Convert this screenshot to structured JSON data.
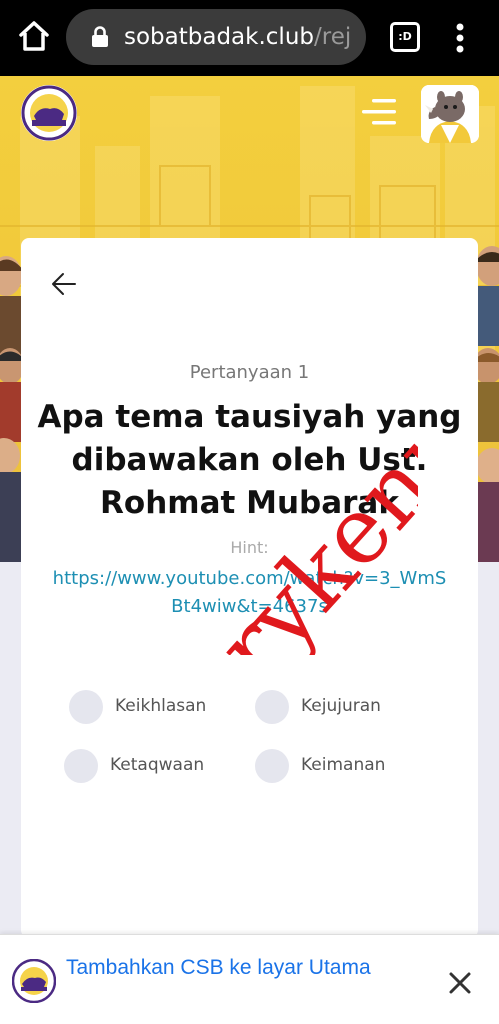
{
  "browser": {
    "url_host": "sobatbadak.club",
    "url_path": "/rej",
    "tab_count": ":D"
  },
  "site": {
    "logo_icon": "csb-logo-icon",
    "menu_icon": "hamburger-icon",
    "avatar_icon": "rhino-avatar-icon"
  },
  "quiz": {
    "question_number": "Pertanyaan 1",
    "question_text": "Apa tema tausiyah yang dibawakan oleh Ust. Rohmat Mubarak",
    "hint_label": "Hint:",
    "hint_link": "https://www.youtube.com/watch?v=3_WmSBt4wiw&t=4637s",
    "options": [
      {
        "label": "Keikhlasan"
      },
      {
        "label": "Kejujuran"
      },
      {
        "label": "Ketaqwaan"
      },
      {
        "label": "Keimanan"
      }
    ]
  },
  "watermark": "rykenpb",
  "add_to_home": {
    "text": "Tambahkan CSB ke layar Utama"
  },
  "colors": {
    "hero_yellow": "#f2c93a",
    "link": "#1d8fb3",
    "banner_text": "#1a73e8",
    "watermark": "#e0191d"
  }
}
